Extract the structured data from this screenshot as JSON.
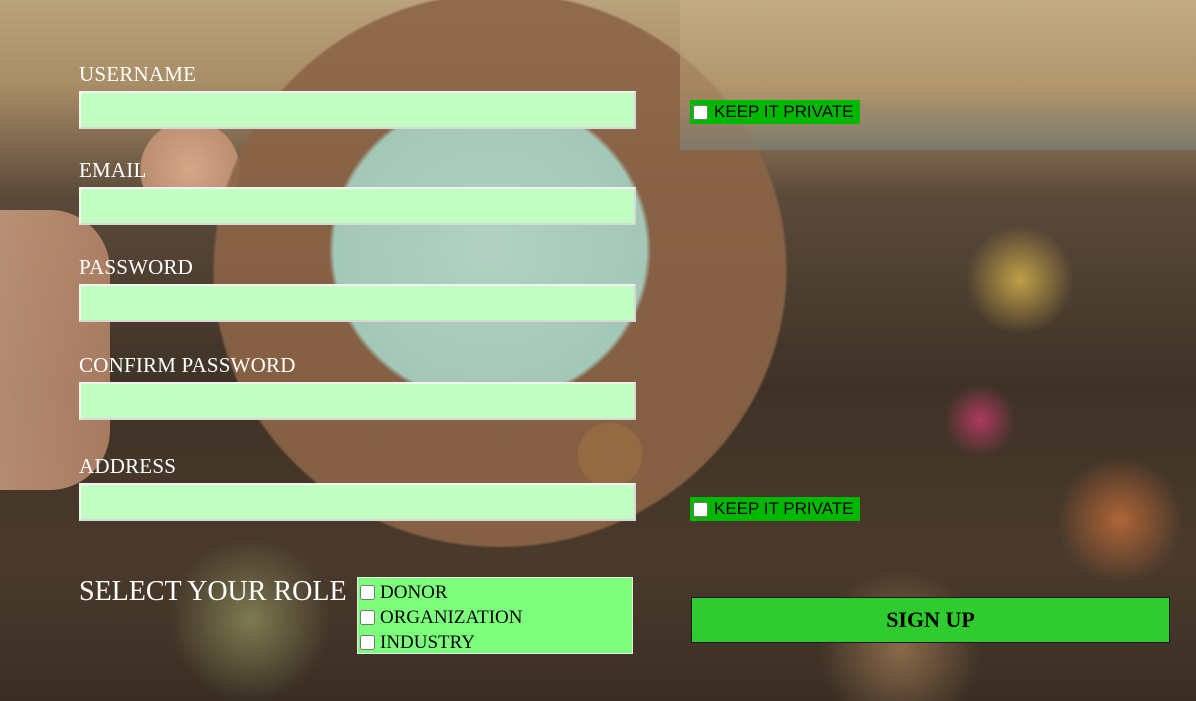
{
  "form": {
    "fields": [
      {
        "label": "USERNAME",
        "value": "",
        "placeholder": ""
      },
      {
        "label": "EMAIL",
        "value": "",
        "placeholder": ""
      },
      {
        "label": "PASSWORD",
        "value": "",
        "placeholder": ""
      },
      {
        "label": "CONFIRM PASSWORD",
        "value": "",
        "placeholder": ""
      },
      {
        "label": "ADDRESS",
        "value": "",
        "placeholder": ""
      }
    ],
    "private_toggles": [
      {
        "label": "KEEP IT PRIVATE",
        "checked": false
      },
      {
        "label": "KEEP IT PRIVATE",
        "checked": false
      }
    ],
    "role": {
      "title": "SELECT YOUR ROLE",
      "options": [
        {
          "label": "DONOR",
          "checked": false
        },
        {
          "label": "ORGANIZATION",
          "checked": false
        },
        {
          "label": "INDUSTRY",
          "checked": false
        }
      ]
    },
    "submit_label": "SIGN UP"
  },
  "colors": {
    "field_bg": "#c3ffc3",
    "private_bg": "#00b800",
    "role_box_bg": "#7dff7d",
    "button_bg": "#2ecc2e",
    "label_text": "#ffffff"
  },
  "background": {
    "description_icon": "compost-food-scraps-photo"
  }
}
